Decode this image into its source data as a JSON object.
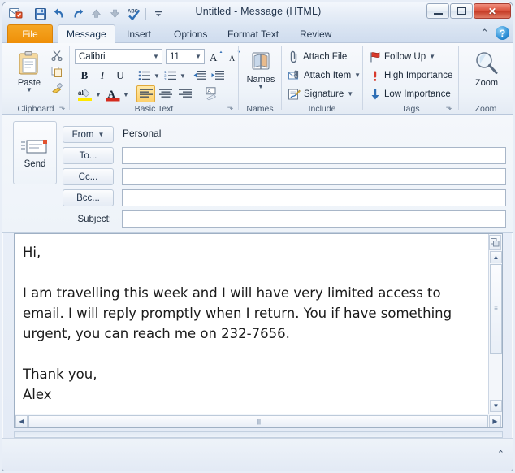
{
  "window": {
    "title": "Untitled  -  Message (HTML)",
    "controls": [
      {
        "name": "minimize",
        "glyph": "–"
      },
      {
        "name": "maximize",
        "glyph": "□"
      },
      {
        "name": "close",
        "glyph": "✕"
      }
    ]
  },
  "quick_access": [
    {
      "name": "app-icon",
      "label": "Outlook"
    },
    {
      "name": "save-icon",
      "label": "Save"
    },
    {
      "name": "undo-icon",
      "label": "Undo"
    },
    {
      "name": "redo-icon",
      "label": "Redo"
    },
    {
      "name": "previous-item-icon",
      "label": "Previous Item"
    },
    {
      "name": "next-item-icon",
      "label": "Next Item"
    },
    {
      "name": "spelling-icon",
      "label": "Spelling & Grammar"
    },
    {
      "name": "customize-qat-icon",
      "label": "Customize Quick Access Toolbar"
    }
  ],
  "tabs": [
    {
      "label": "File",
      "active": false,
      "file": true
    },
    {
      "label": "Message",
      "active": true,
      "file": false
    },
    {
      "label": "Insert",
      "active": false,
      "file": false
    },
    {
      "label": "Options",
      "active": false,
      "file": false
    },
    {
      "label": "Format Text",
      "active": false,
      "file": false
    },
    {
      "label": "Review",
      "active": false,
      "file": false
    }
  ],
  "tab_right": {
    "collapse_ribbon": "⌃",
    "help": "?"
  },
  "ribbon": {
    "clipboard": {
      "group_label": "Clipboard",
      "paste_label": "Paste",
      "cut_label": "Cut",
      "copy_label": "Copy",
      "format_painter_label": "Format Painter",
      "launcher": "⬎"
    },
    "basic_text": {
      "group_label": "Basic Text",
      "font_name": "Calibri",
      "font_size": "11",
      "grow_font": "A",
      "shrink_font": "A",
      "bold": "B",
      "italic": "I",
      "underline": "U",
      "bullets": "bullets",
      "numbering": "numbering",
      "decrease_indent": "decrease-indent",
      "increase_indent": "increase-indent",
      "highlight": "ab",
      "font_color": "A",
      "align_left": "align-left",
      "align_center": "align-center",
      "align_right": "align-right",
      "clear_formatting": "Aᴀ",
      "launcher": "⬎"
    },
    "names": {
      "group_label": "Names",
      "names_label": "Names"
    },
    "include": {
      "group_label": "Include",
      "items": [
        {
          "label": "Attach File",
          "icon": "paperclip-icon",
          "dropdown": false
        },
        {
          "label": "Attach Item",
          "icon": "attach-item-icon",
          "dropdown": true
        },
        {
          "label": "Signature",
          "icon": "signature-icon",
          "dropdown": true
        }
      ]
    },
    "tags": {
      "group_label": "Tags",
      "launcher": "⬎",
      "items": [
        {
          "label": "Follow Up",
          "icon": "flag-icon",
          "dropdown": true
        },
        {
          "label": "High Importance",
          "icon": "exclamation-icon",
          "dropdown": false
        },
        {
          "label": "Low Importance",
          "icon": "down-arrow-icon",
          "dropdown": false
        }
      ]
    },
    "zoom": {
      "group_label": "Zoom",
      "zoom_label": "Zoom"
    }
  },
  "compose": {
    "send_label": "Send",
    "from_label": "From",
    "from_account": "Personal",
    "to_label": "To...",
    "to_value": "",
    "cc_label": "Cc...",
    "cc_value": "",
    "bcc_label": "Bcc...",
    "bcc_value": "",
    "subject_label": "Subject:",
    "subject_value": ""
  },
  "body": {
    "text": "Hi,\n\nI am travelling this week and I will have very limited access to email. I will reply promptly when I return. You if have something urgent, you can reach me on 232-7656.\n\nThank you,\nAlex"
  },
  "scrollbars": {
    "v_up": "▲",
    "v_down": "▼",
    "v_grip": "≡",
    "h_left": "◀",
    "h_right": "▶",
    "h_grip": "||||",
    "split_handle": "split-handle"
  },
  "status": {
    "expand_chevron": "⌃"
  },
  "colors": {
    "file_tab": "#ef8f08",
    "close_button": "#c53a25",
    "accent_highlight": "#fdd06a",
    "window_border": "#9aa9bd"
  }
}
